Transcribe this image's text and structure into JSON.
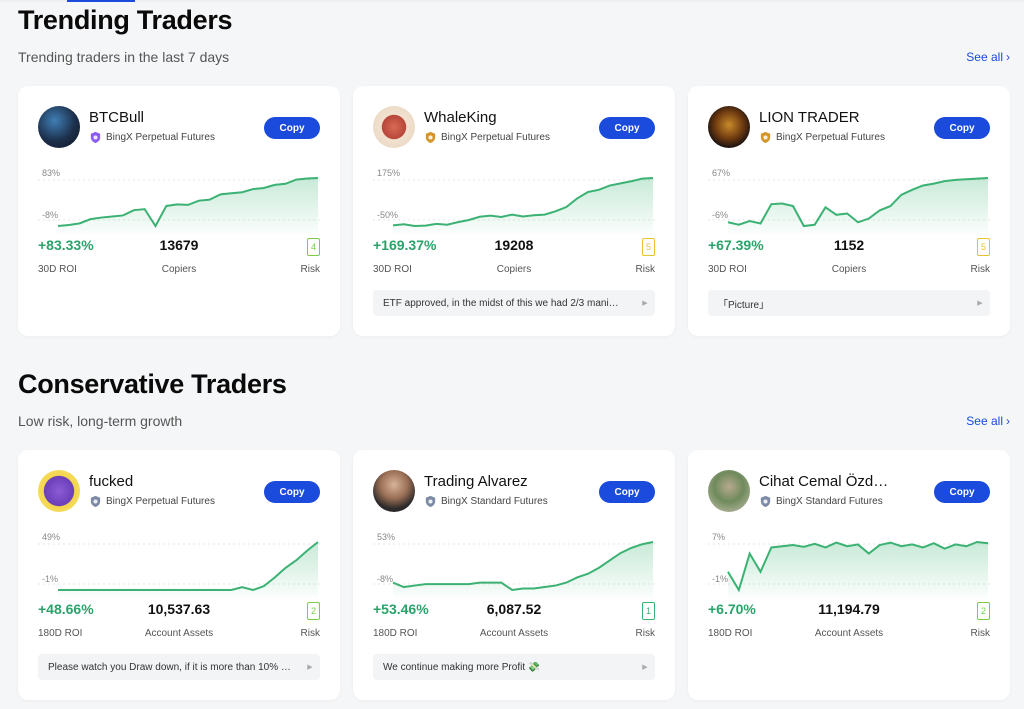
{
  "sections": [
    {
      "title": "Trending Traders",
      "subtitle": "Trending traders in the last 7 days",
      "see_all": "See all"
    },
    {
      "title": "Conservative Traders",
      "subtitle": "Low risk, long-term growth",
      "see_all": "See all"
    }
  ],
  "copy_label": "Copy",
  "cards": [
    {
      "name": "BTCBull",
      "platform": "BingX Perpetual Futures",
      "badge": "purple-shield-badge-icon",
      "y_high": "83%",
      "y_low": "-8%",
      "roi": "+83.33%",
      "roi_label": "30D ROI",
      "mid_value": "13679",
      "mid_label": "Copiers",
      "risk": "4",
      "risk_label": "Risk",
      "risk_color": "#7ccc4a",
      "note": "",
      "series": [
        -8,
        -6,
        -3,
        5,
        8,
        10,
        12,
        22,
        24,
        -8,
        30,
        33,
        32,
        40,
        42,
        52,
        54,
        56,
        62,
        64,
        70,
        72,
        80,
        82,
        83
      ]
    },
    {
      "name": "WhaleKing",
      "platform": "BingX Perpetual Futures",
      "badge": "gold-shield-badge-icon",
      "y_high": "175%",
      "y_low": "-50%",
      "roi": "+169.37%",
      "roi_label": "30D ROI",
      "mid_value": "19208",
      "mid_label": "Copiers",
      "risk": "5",
      "risk_label": "Risk",
      "risk_color": "#e8c234",
      "note": "ETF approved, in the midst of this we had 2/3 mani…",
      "series": [
        -45,
        -40,
        -48,
        -46,
        -38,
        -42,
        -30,
        -20,
        -5,
        0,
        -6,
        5,
        -4,
        2,
        5,
        20,
        40,
        80,
        110,
        120,
        140,
        150,
        160,
        172,
        175
      ]
    },
    {
      "name": "LION TRADER",
      "platform": "BingX Perpetual Futures",
      "badge": "gold-shield-badge-icon",
      "y_high": "67%",
      "y_low": "-6%",
      "roi": "+67.39%",
      "roi_label": "30D ROI",
      "mid_value": "1152",
      "mid_label": "Copiers",
      "risk": "5",
      "risk_label": "Risk",
      "risk_color": "#e8c234",
      "note": "「Picture」",
      "series": [
        -4,
        -8,
        -2,
        -6,
        25,
        26,
        22,
        -10,
        -8,
        20,
        8,
        10,
        -4,
        2,
        15,
        22,
        40,
        48,
        55,
        58,
        62,
        64,
        65,
        66,
        67
      ]
    },
    {
      "name": "fucked",
      "platform": "BingX Perpetual Futures",
      "badge": "gray-shield-badge-icon",
      "y_high": "49%",
      "y_low": "-1%",
      "roi": "+48.66%",
      "roi_label": "180D ROI",
      "mid_value": "10,537.63",
      "mid_label": "Account Assets",
      "risk": "2",
      "risk_label": "Risk",
      "risk_color": "#7ccc4a",
      "note": "Please watch you Draw down, if it is more than 10% …",
      "series": [
        -1,
        -1,
        -1,
        -1,
        -1,
        -1,
        -1,
        -1,
        -1,
        -1,
        -1,
        -1,
        -1,
        -1,
        -1,
        -1,
        -1,
        2,
        -1,
        3,
        12,
        22,
        30,
        40,
        49
      ]
    },
    {
      "name": "Trading Alvarez",
      "platform": "BingX Standard Futures",
      "badge": "gray-shield-badge-icon",
      "y_high": "53%",
      "y_low": "-8%",
      "roi": "+53.46%",
      "roi_label": "180D ROI",
      "mid_value": "6,087.52",
      "mid_label": "Account Assets",
      "risk": "1",
      "risk_label": "Risk",
      "risk_color": "#3bb273",
      "note": "We continue making more Profit 💸",
      "series": [
        -2,
        -8,
        -6,
        -4,
        -4,
        -4,
        -4,
        -4,
        -2,
        -2,
        -2,
        -12,
        -10,
        -10,
        -8,
        -6,
        -2,
        5,
        10,
        18,
        28,
        38,
        45,
        50,
        53
      ]
    },
    {
      "name": "Cihat Cemal Özd…",
      "platform": "BingX Standard Futures",
      "badge": "gray-shield-badge-icon",
      "y_high": "7%",
      "y_low": "-1%",
      "roi": "+6.70%",
      "roi_label": "180D ROI",
      "mid_value": "11,194.79",
      "mid_label": "Account Assets",
      "risk": "2",
      "risk_label": "Risk",
      "risk_color": "#7ccc4a",
      "note": "",
      "series": [
        2,
        -1,
        5,
        2,
        6,
        6.2,
        6.4,
        6.1,
        6.6,
        6,
        6.8,
        6.2,
        6.5,
        5,
        6.4,
        6.8,
        6.2,
        6.5,
        6,
        6.7,
        5.8,
        6.5,
        6.2,
        6.9,
        6.7
      ]
    }
  ]
}
